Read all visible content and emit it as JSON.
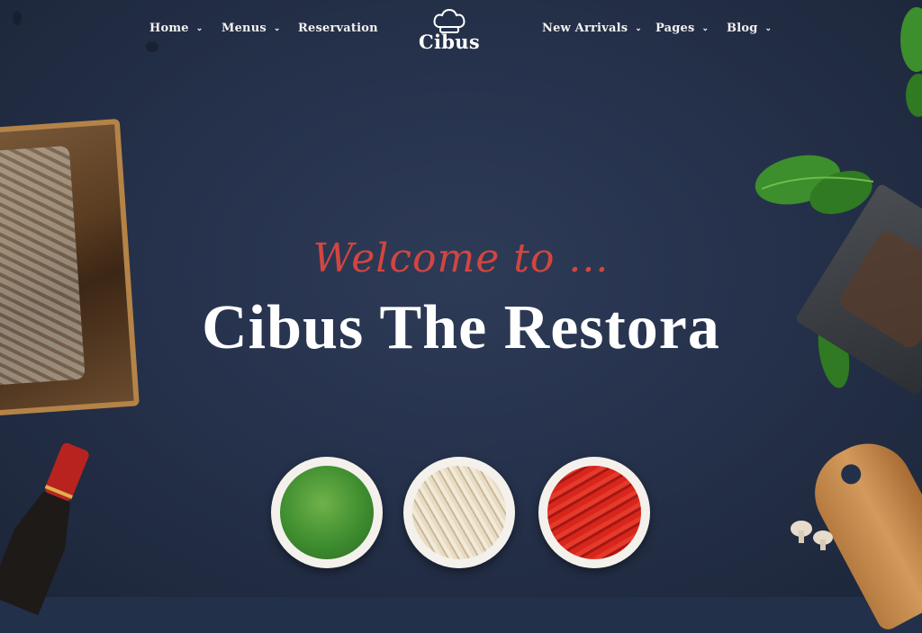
{
  "nav": {
    "left": [
      {
        "label": "Home",
        "has_dropdown": true
      },
      {
        "label": "Menus",
        "has_dropdown": true
      },
      {
        "label": "Reservation",
        "has_dropdown": false
      }
    ],
    "right": [
      {
        "label": "New Arrivals",
        "has_dropdown": true
      },
      {
        "label": "Pages",
        "has_dropdown": true
      },
      {
        "label": "Blog",
        "has_dropdown": true
      }
    ],
    "chevron": "⌄"
  },
  "logo": {
    "text": "Cibus",
    "icon": "chef-hat-icon"
  },
  "hero": {
    "welcome": "Welcome to ...",
    "title": "Cibus The Restora"
  },
  "colors": {
    "background": "#23304a",
    "accent": "#d2463f",
    "text": "#ffffff"
  }
}
